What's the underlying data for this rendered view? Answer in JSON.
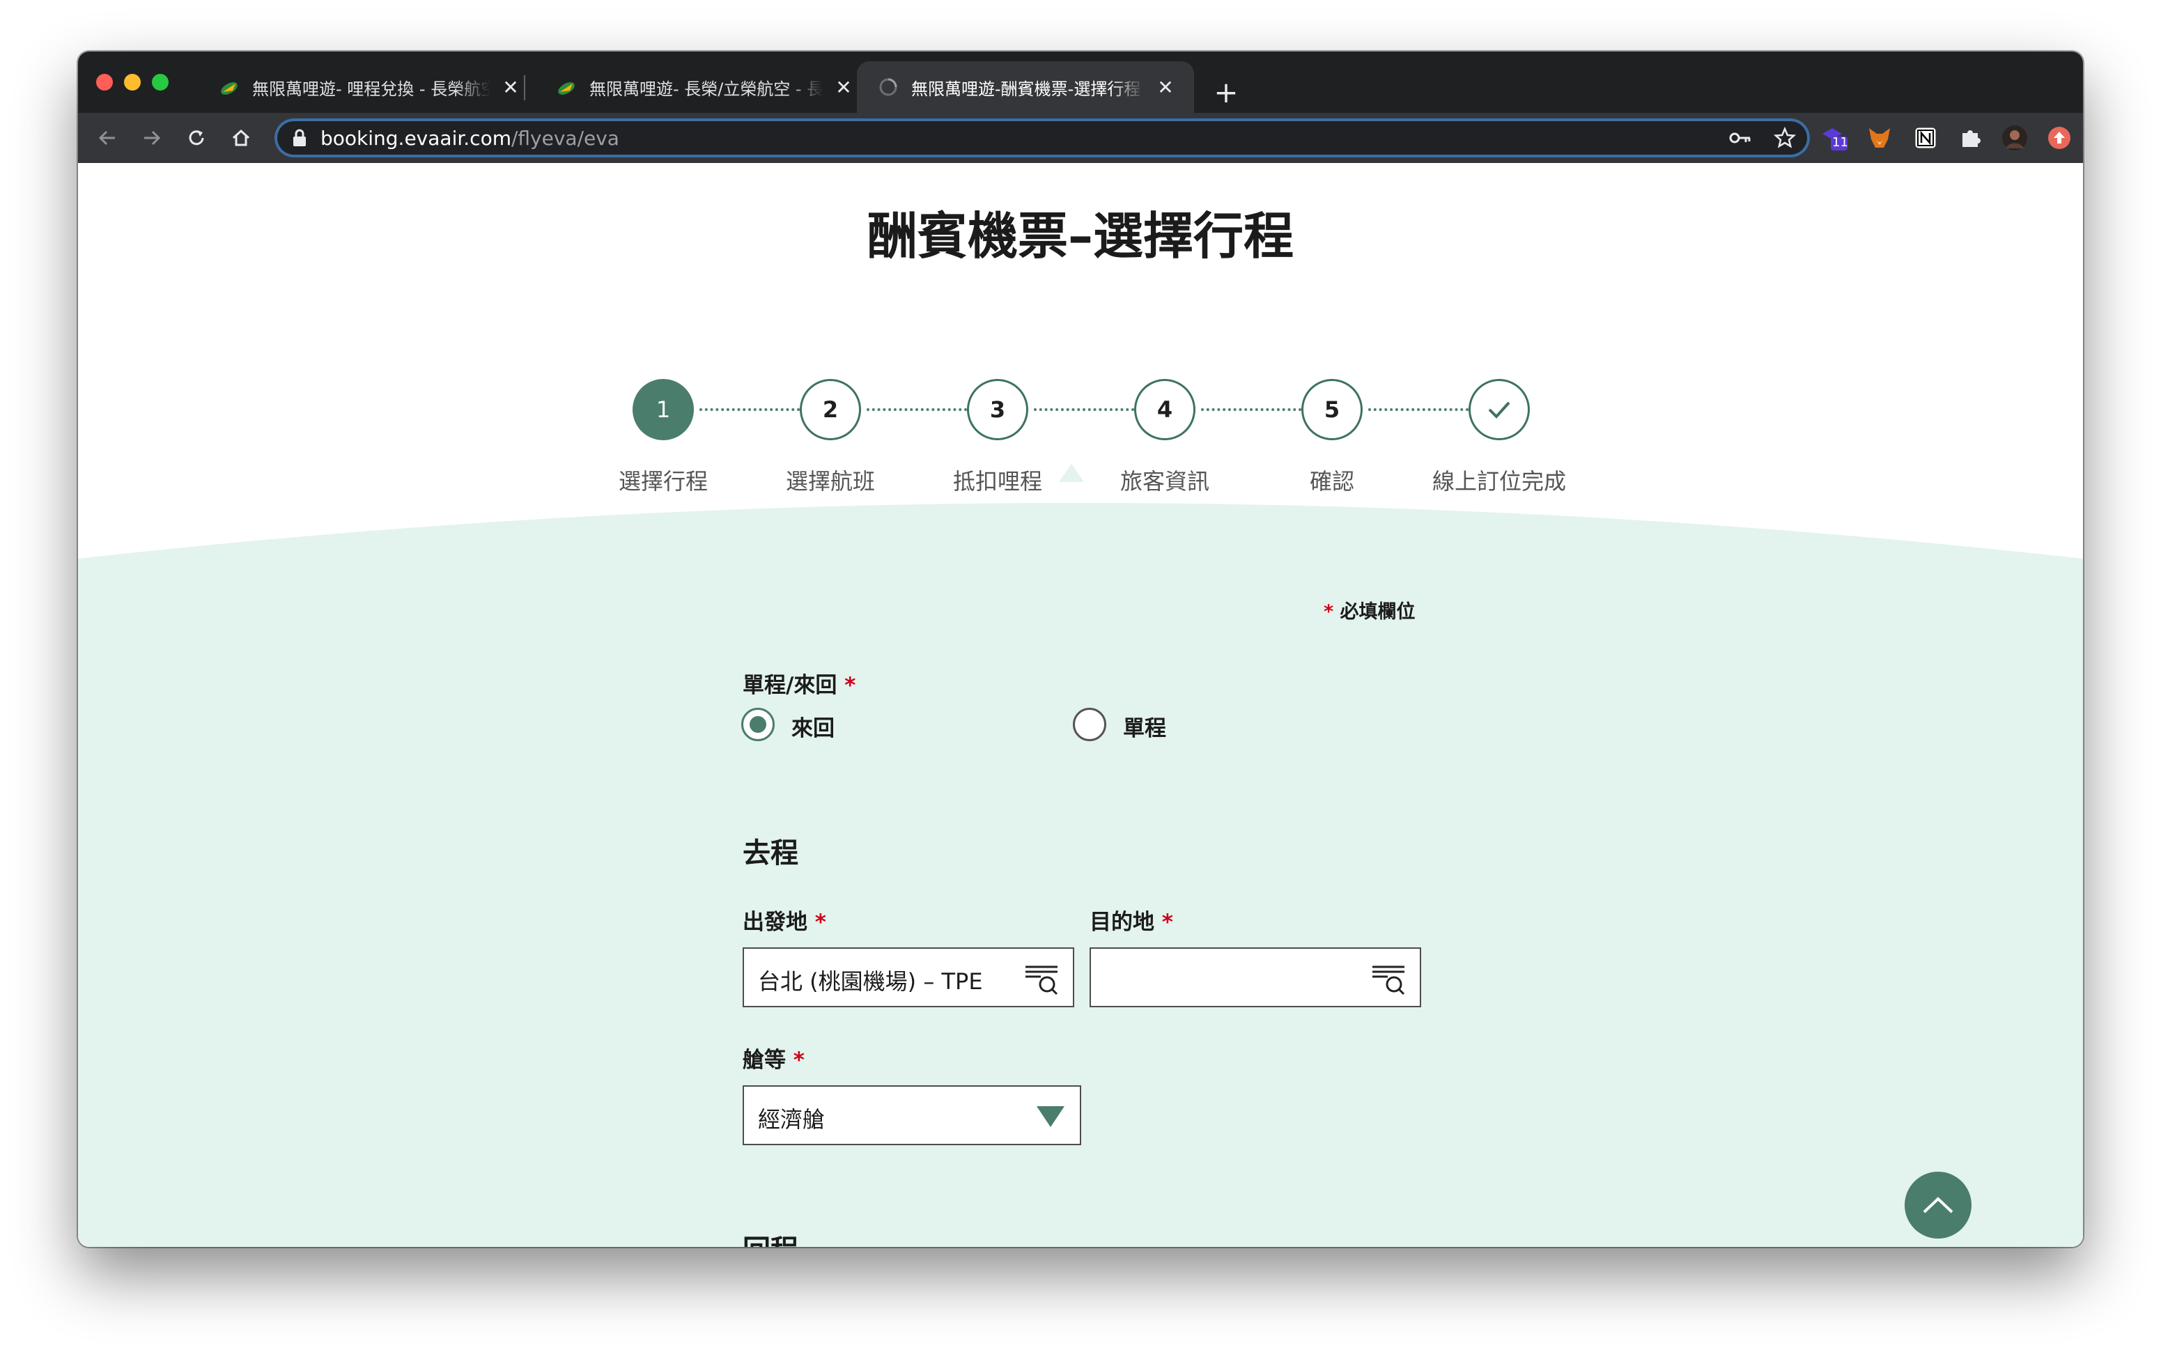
{
  "browser": {
    "tabs": [
      {
        "title": "無限萬哩遊- 哩程兌換 - 長榮航空",
        "favicon": "eva-air-icon"
      },
      {
        "title": "無限萬哩遊- 長榮/立榮航空 - 長榮航空",
        "favicon": "eva-air-icon"
      },
      {
        "title": "無限萬哩遊-酬賓機票-選擇行程 - 長榮航空",
        "favicon": "loading-globe-icon",
        "active": true
      }
    ],
    "new_tab": "+",
    "close_glyph": "✕",
    "url": {
      "host": "booking.evaair.com",
      "path": "/flyeva/eva"
    },
    "extension_badge": "11"
  },
  "page": {
    "title": "酬賓機票–選擇行程",
    "steps": [
      {
        "number": "1",
        "label": "選擇行程",
        "active": true
      },
      {
        "number": "2",
        "label": "選擇航班"
      },
      {
        "number": "3",
        "label": "抵扣哩程"
      },
      {
        "number": "4",
        "label": "旅客資訊"
      },
      {
        "number": "5",
        "label": "確認"
      },
      {
        "number": "",
        "label": "線上訂位完成",
        "icon": "checkmark-icon"
      }
    ],
    "required_star": "*",
    "required_note": "必填欄位",
    "trip_type": {
      "label": "單程/來回",
      "options": [
        {
          "label": "來回",
          "checked": true
        },
        {
          "label": "單程",
          "checked": false
        }
      ]
    },
    "outbound": {
      "title": "去程",
      "origin": {
        "label": "出發地",
        "value": "台北 (桃園機場) – TPE"
      },
      "destination": {
        "label": "目的地",
        "value": ""
      },
      "cabin": {
        "label": "艙等",
        "value": "經濟艙"
      }
    },
    "return": {
      "title": "回程"
    }
  },
  "colors": {
    "brand_green": "#4a7d6c",
    "mint_background": "#e3f3ed",
    "required_red": "#d0021b"
  }
}
